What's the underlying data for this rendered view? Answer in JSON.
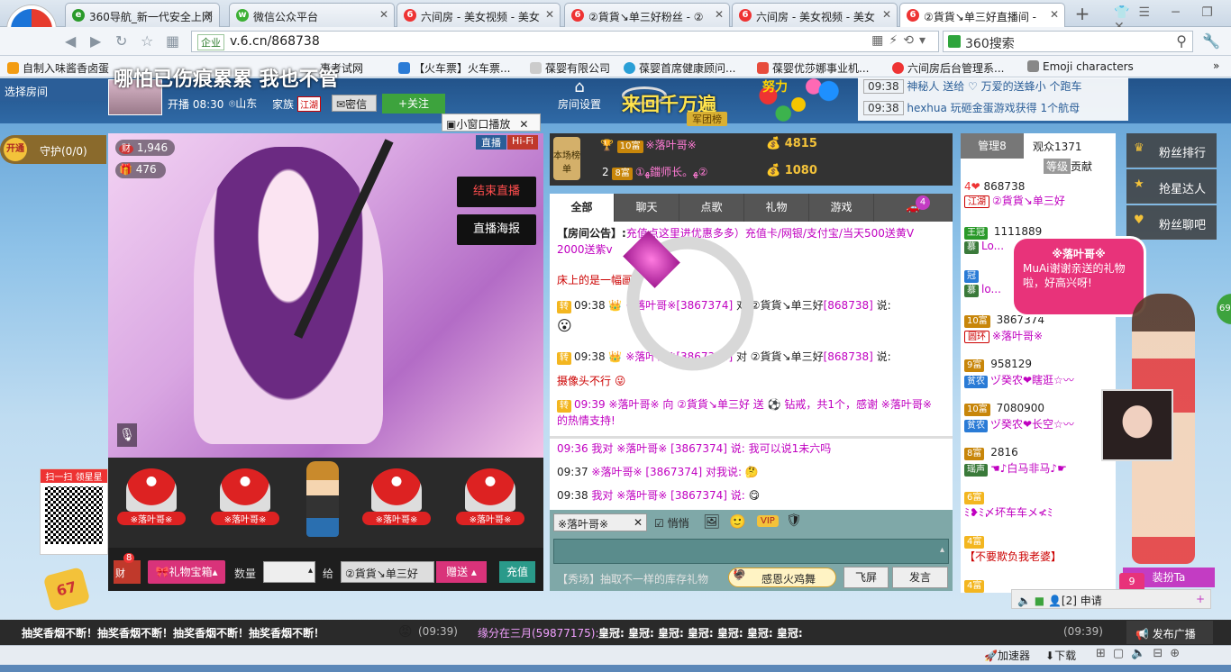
{
  "browser": {
    "tabs": [
      {
        "label": "360导航_新一代安全上网"
      },
      {
        "label": "微信公众平台"
      },
      {
        "label": "六间房 - 美女视频 - 美女"
      },
      {
        "label": "②貨貨↘单三好粉丝 - ②"
      },
      {
        "label": "六间房 - 美女视频 - 美女"
      },
      {
        "label": "②貨貨↘单三好直播间 - "
      }
    ],
    "url_prefix": "企业",
    "url": "v.6.cn/868738",
    "search_placeholder": "360搜索",
    "bookmarks": [
      "自制入味酱香卤蛋",
      "哪怕已伤痕累累  我也不管",
      "事考试网",
      "【火车票】火车票...",
      "葆婴有限公司",
      "葆婴首席健康顾问...",
      "葆婴优莎娜事业机...",
      "六间房后台管理系...",
      "Emoji characters"
    ]
  },
  "room": {
    "select_room": "选择房间",
    "host_intro": "哪怕已伤痕累累  我也不管",
    "start_time": "开播 08:30",
    "location": "山东",
    "family_label": "家族",
    "family_badge": "江湖",
    "private_msg": "密信",
    "follow": "+关注",
    "mini_window": "小窗口播放",
    "room_settings": "房间设置",
    "banner": "来回千万遍",
    "banner_sub": "军团榜",
    "banner_top": "努力",
    "guard": "守护(0/0)",
    "guard_open": "开通",
    "wealth": "1,946",
    "likes": "476",
    "live_tag": "直播",
    "hifi_tag": "Hi-Fi",
    "end_live": "结束直播",
    "live_poster": "直播海报",
    "scan_text": "扫一扫 领星星"
  },
  "ticker": [
    {
      "time": "09:38",
      "text": "神秘人 送给 ♡ 万爱的送蜂小 个跑车"
    },
    {
      "time": "09:38",
      "text": "hexhua 玩砸金蛋游戏获得 1个航母"
    }
  ],
  "ranking": {
    "title": "本场榜单",
    "rows": [
      {
        "rank": "1",
        "level": "10富",
        "name": "※落叶哥※",
        "score": "4815"
      },
      {
        "rank": "2",
        "level": "8富",
        "name": "①ﻬ鍿师长。ﻬ②",
        "score": "1080"
      }
    ]
  },
  "chat_tabs": [
    "全部",
    "聊天",
    "点歌",
    "礼物",
    "游戏"
  ],
  "chat_tab_badge": "4",
  "chat": {
    "notice_label": "【房间公告】:",
    "notice_text": "充值点这里进优惠多多）充值卡/网银/支付宝/当天500送黄V 2000送紫v",
    "line2": "床上的是一幅画",
    "msgs": [
      {
        "badge": "转",
        "time": "09:38",
        "from": "※落叶哥※",
        "from_id": "[3867374]",
        "to": "对 ②貨貨↘单三好",
        "to_id": "[868738]",
        "say": "说:"
      },
      {
        "badge": "转",
        "time": "09:38",
        "from": "※落叶哥※",
        "from_id": "[3867374]",
        "to": "对 ②貨貨↘单三好",
        "to_id": "[868738]",
        "say": "说:"
      }
    ],
    "line_cam": "摄像头不行",
    "gift_line": "09:39 ※落叶哥※ 向 ②貨貨↘单三好 送 ⚽ 钻戒，共1个，感谢 ※落叶哥※ 的热情支持!",
    "private": [
      {
        "time": "09:36",
        "text": "我对 ※落叶哥※ [3867374] 说: 我可以说1未六吗"
      },
      {
        "time": "09:37",
        "text": "※落叶哥※ [3867374] 对我说:"
      },
      {
        "time": "09:38",
        "text": "我对 ※落叶哥※ [3867374] 说:"
      }
    ],
    "target": "※落叶哥※",
    "whisper": "悄悄",
    "vip": "VIP",
    "show_text": "【秀场】抽取不一样的库存礼物",
    "chicken": "感恩火鸡舞",
    "fly": "飞屏",
    "send": "发言"
  },
  "gift_bar": {
    "box": "礼物宝箱",
    "qty_label": "数量",
    "to_label": "给",
    "to_value": "②貨貨↘单三好",
    "give": "赠送",
    "recharge": "充值",
    "wealth_badge": "财",
    "wealth_num": "8",
    "seats": [
      "※落叶哥※",
      "※落叶哥※",
      "※落叶哥※",
      "※落叶哥※"
    ]
  },
  "audience": {
    "tab_admin": "管理8",
    "tab_viewers": "观众1371",
    "sub_level": "等级",
    "sub_contrib": "贡献",
    "users": [
      {
        "level": "4",
        "id": "868738",
        "badge": "江湖",
        "name": "②貨貨↘单三好"
      },
      {
        "level": "王冠",
        "id": "1111889",
        "badge": "慕",
        "name": "Lo..."
      },
      {
        "level": "冠",
        "id": "",
        "badge": "慕",
        "name": "lo..."
      },
      {
        "level": "10富",
        "id": "3867374",
        "badge": "圆环",
        "name": "※落叶哥※"
      },
      {
        "level": "9富",
        "id": "958129",
        "badge": "贫农",
        "name": "ヅ癸农❤瞎逛☆〰"
      },
      {
        "level": "10富",
        "id": "7080900",
        "badge": "贫农",
        "name": "ヅ癸农❤长空☆〰"
      },
      {
        "level": "8富",
        "id": "2816",
        "badge": "瑶声",
        "name": "☚♪白马非马♪☛"
      },
      {
        "level": "6富",
        "id": "",
        "badge": "",
        "name": "ﾐ❥ﾐ〆坏车车メ≮ﾐ"
      },
      {
        "level": "4富",
        "id": "",
        "badge": "",
        "name": "【不要欺负我老婆】"
      },
      {
        "level": "4富",
        "id": "",
        "badge": "",
        "name": ""
      }
    ],
    "apply": "申请",
    "mic_count": "[2]"
  },
  "side": {
    "fans_rank": "粉丝排行",
    "grab_star": "抢星达人",
    "fans_chat": "粉丝聊吧",
    "bubble_name": "※落叶哥※",
    "bubble_text": "MuAi谢谢亲送的礼物啦，好高兴呀!",
    "dress": "装扮Ta",
    "dress_badge": "9",
    "right_edge": "69"
  },
  "broadcast": {
    "text": "抽奖香烟不断！抽奖香烟不断！抽奖香烟不断！抽奖香烟不断！",
    "time1": "(09:39)",
    "fate": "缘分在三月(59877175):",
    "crowns": "皇冠: 皇冠: 皇冠: 皇冠: 皇冠: 皇冠: 皇冠:",
    "time2": "(09:39)",
    "publish": "发布广播"
  },
  "statusbar": {
    "accelerator": "加速器",
    "download": "下载"
  }
}
